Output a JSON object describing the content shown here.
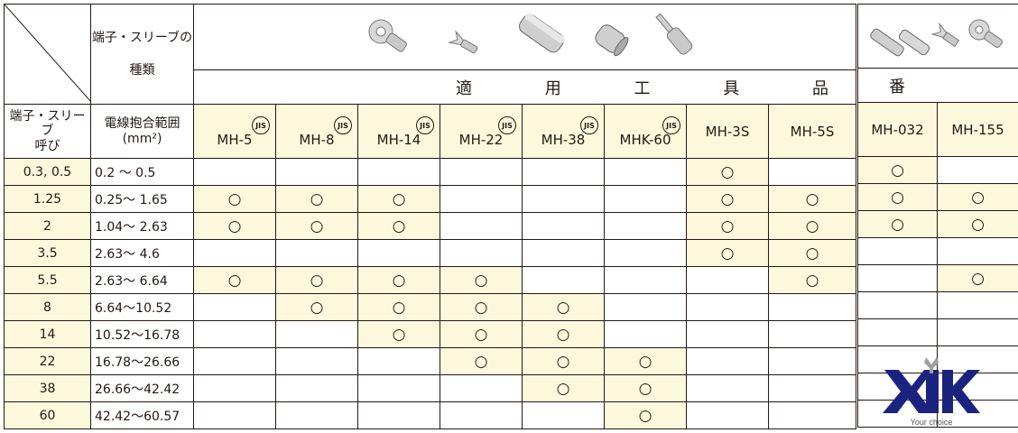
{
  "header": {
    "type_label_line1": "端子・スリーブの",
    "type_label_line2": "種類",
    "applicable_tools": [
      "適",
      "用",
      "工",
      "具",
      "品"
    ],
    "product_no": "番",
    "col1_label_line1": "端子・スリーブ",
    "col1_label_line2": "呼び",
    "col2_label_line1": "電線抱合範囲",
    "col2_label_line2": "(mm²)"
  },
  "jis_mark": "JIS",
  "icons": [
    "ring-terminal-icon",
    "fork-terminal-icon",
    "butt-sleeve-icon",
    "ring-sleeve-icon",
    "pin-terminal-icon",
    "mixed-terminals-icon"
  ],
  "tools": [
    "MH-5",
    "MH-8",
    "MH-14",
    "MH-22",
    "MH-38",
    "MHK-60",
    "MH-3S",
    "MH-5S",
    "MH-032",
    "MH-155"
  ],
  "tool_jis": [
    true,
    true,
    true,
    true,
    true,
    true,
    false,
    false,
    false,
    false
  ],
  "rows": [
    {
      "size": "0.3, 0.5",
      "range": "0.2 〜 0.5",
      "marks": [
        "",
        "",
        "",
        "",
        "",
        "",
        "○",
        "",
        "○",
        ""
      ]
    },
    {
      "size": "1.25",
      "range": "0.25〜 1.65",
      "marks": [
        "○",
        "○",
        "○",
        "",
        "",
        "",
        "○",
        "○",
        "○",
        "○"
      ]
    },
    {
      "size": "2",
      "range": "1.04〜 2.63",
      "marks": [
        "○",
        "○",
        "○",
        "",
        "",
        "",
        "○",
        "○",
        "○",
        "○"
      ]
    },
    {
      "size": "3.5",
      "range": "2.63〜 4.6",
      "marks": [
        "",
        "",
        "",
        "",
        "",
        "",
        "○",
        "○",
        "",
        ""
      ]
    },
    {
      "size": "5.5",
      "range": "2.63〜 6.64",
      "marks": [
        "○",
        "○",
        "○",
        "○",
        "",
        "",
        "",
        "○",
        "",
        "○"
      ]
    },
    {
      "size": "8",
      "range": "6.64〜10.52",
      "marks": [
        "",
        "○",
        "○",
        "○",
        "○",
        "",
        "",
        "",
        "",
        ""
      ]
    },
    {
      "size": "14",
      "range": "10.52〜16.78",
      "marks": [
        "",
        "",
        "○",
        "○",
        "○",
        "",
        "",
        "",
        "",
        ""
      ]
    },
    {
      "size": "22",
      "range": "16.78〜26.66",
      "marks": [
        "",
        "",
        "",
        "○",
        "○",
        "○",
        "",
        "",
        "",
        ""
      ]
    },
    {
      "size": "38",
      "range": "26.66〜42.42",
      "marks": [
        "",
        "",
        "",
        "",
        "○",
        "○",
        "",
        "",
        "",
        ""
      ]
    },
    {
      "size": "60",
      "range": "42.42〜60.57",
      "marks": [
        "",
        "",
        "",
        "",
        "",
        "○",
        "",
        "",
        "",
        ""
      ]
    }
  ],
  "highlight": [
    [
      0,
      0,
      0,
      0,
      0,
      0,
      1,
      0,
      1,
      0
    ],
    [
      1,
      1,
      1,
      0,
      0,
      0,
      1,
      1,
      1,
      1
    ],
    [
      1,
      1,
      1,
      0,
      0,
      0,
      1,
      1,
      1,
      1
    ],
    [
      0,
      0,
      0,
      0,
      0,
      0,
      1,
      1,
      0,
      0
    ],
    [
      1,
      1,
      1,
      1,
      0,
      0,
      0,
      1,
      0,
      1
    ],
    [
      0,
      1,
      1,
      1,
      1,
      0,
      0,
      0,
      0,
      0
    ],
    [
      0,
      0,
      1,
      1,
      1,
      0,
      0,
      0,
      0,
      0
    ],
    [
      0,
      0,
      0,
      1,
      1,
      1,
      0,
      0,
      0,
      0
    ],
    [
      0,
      0,
      0,
      0,
      1,
      1,
      0,
      0,
      0,
      0
    ],
    [
      0,
      0,
      0,
      0,
      0,
      1,
      0,
      0,
      0,
      0
    ]
  ],
  "logo": {
    "text": "XJK",
    "tagline": "Your choice",
    "color": "#1a237e"
  },
  "colors": {
    "highlight": "#fcf8dc",
    "border": "#231815"
  }
}
